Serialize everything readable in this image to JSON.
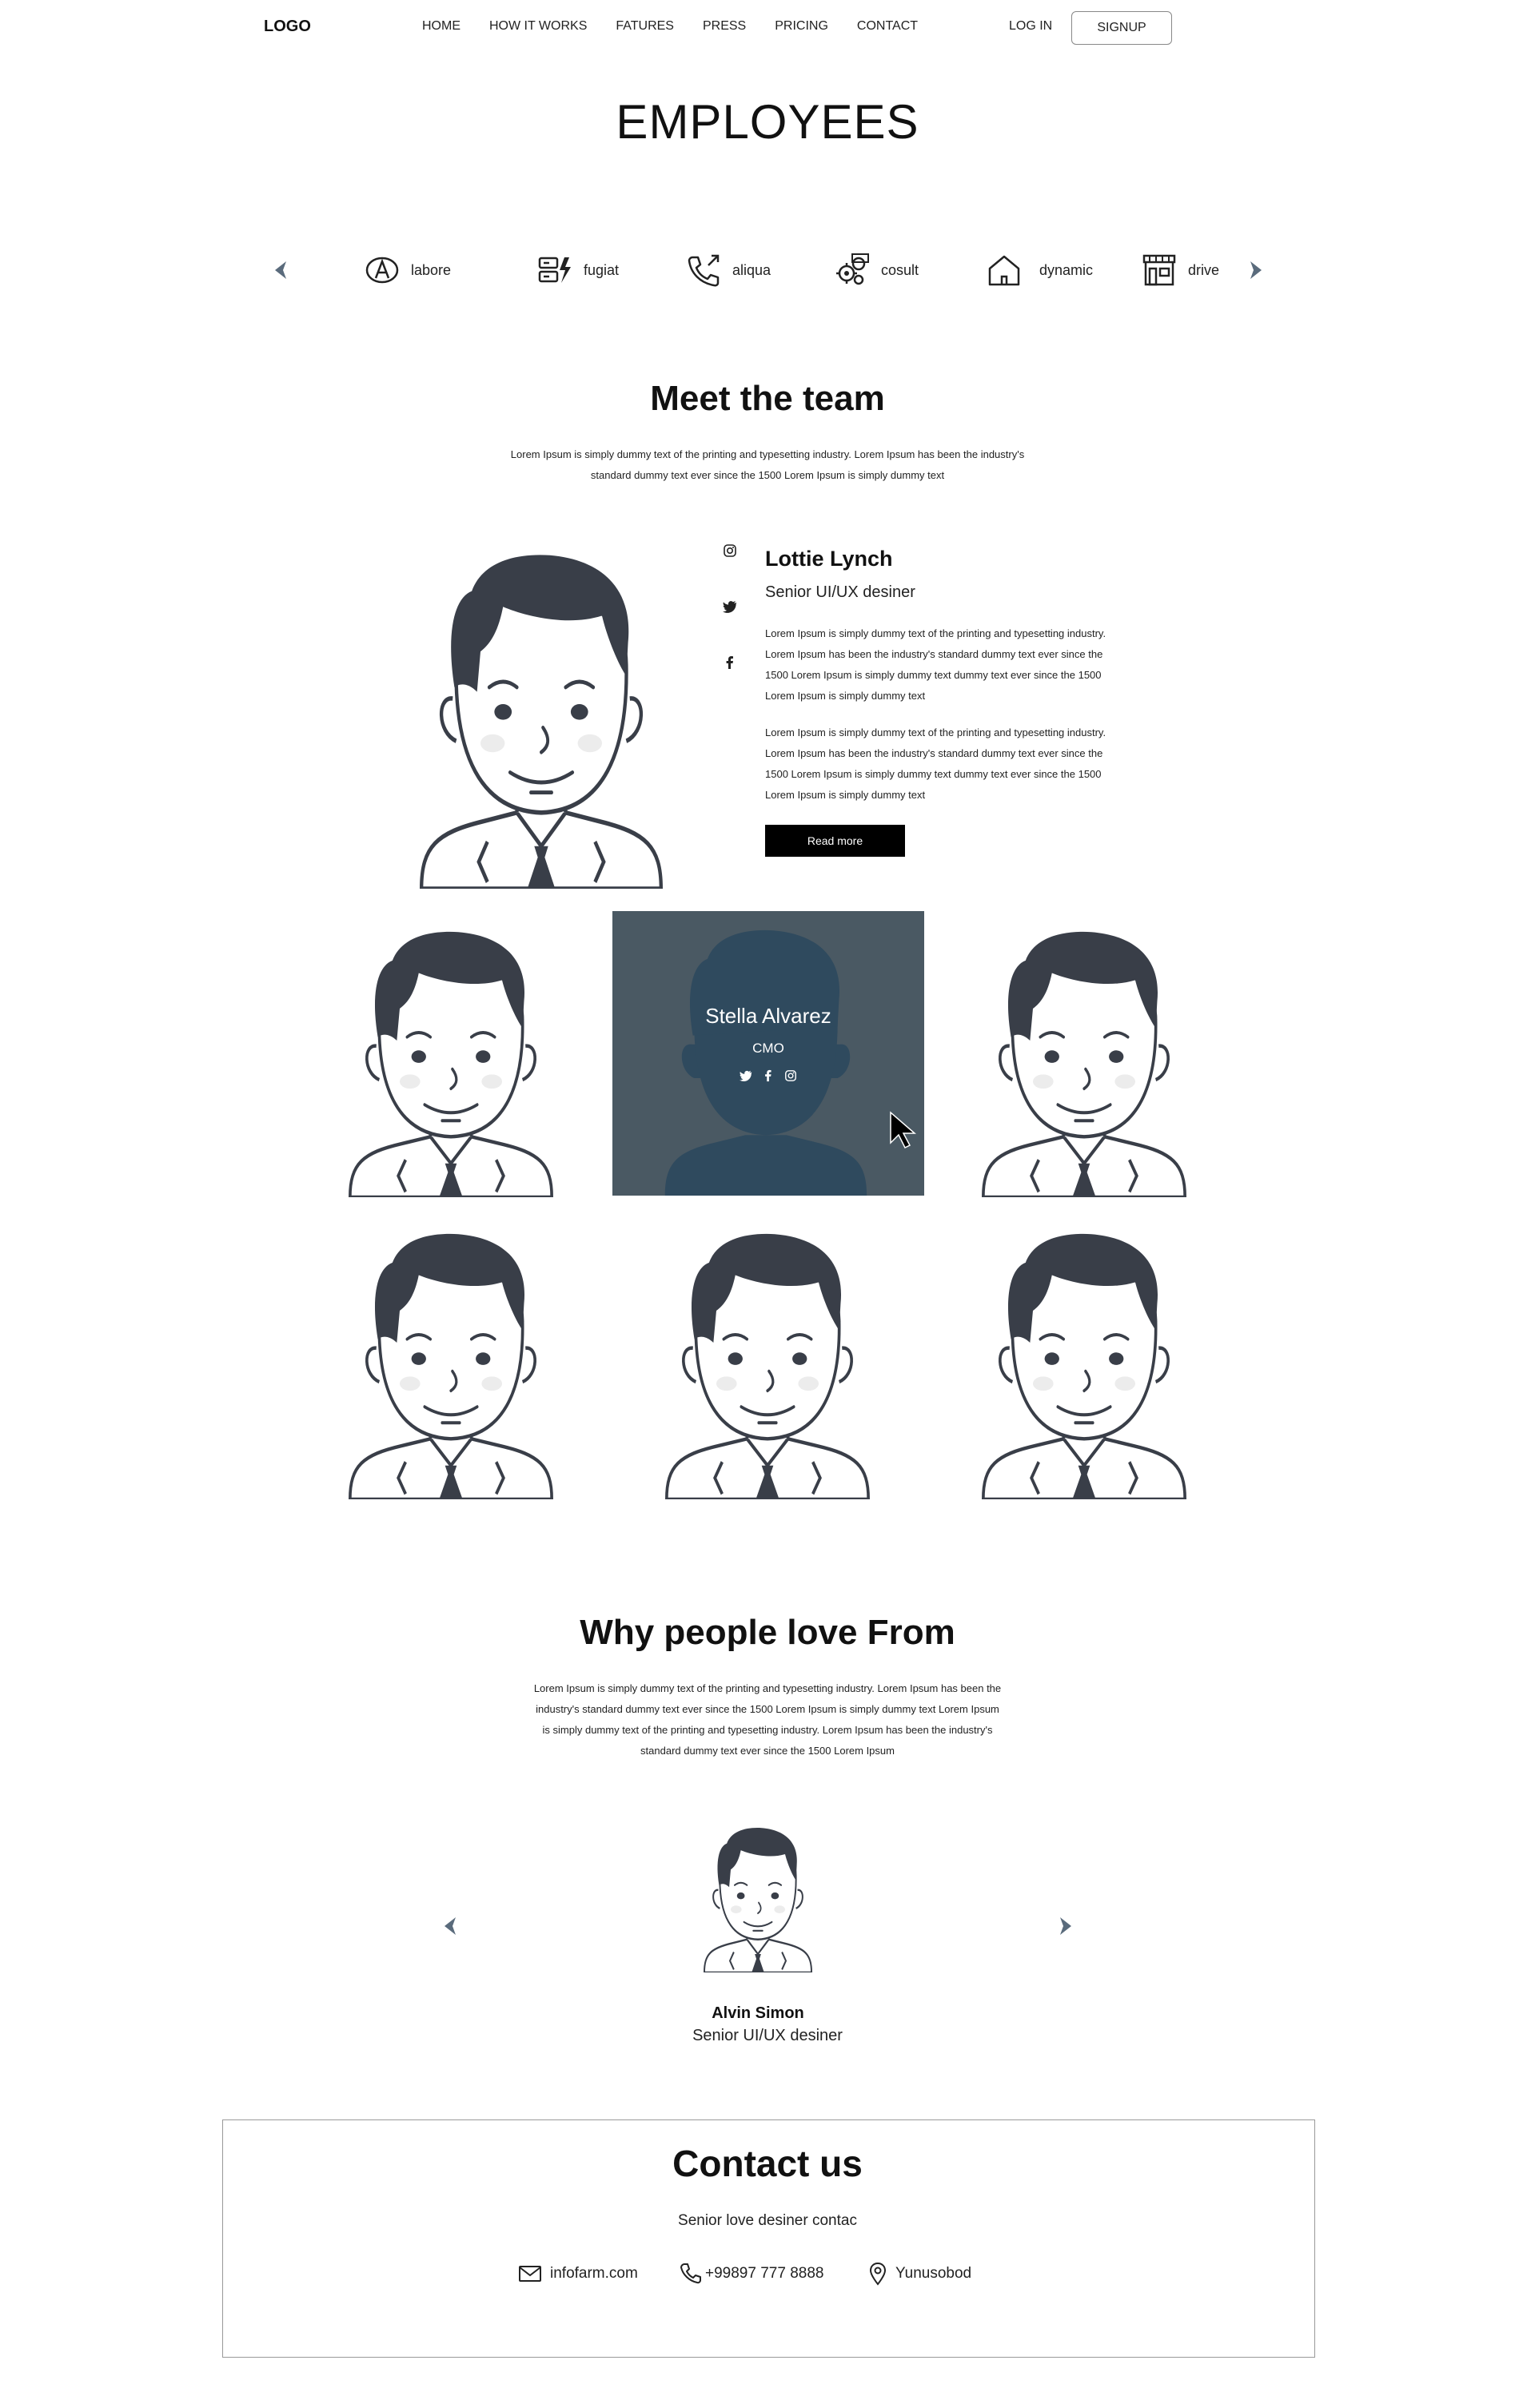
{
  "nav": {
    "logo": "LOGO",
    "links": [
      "HOME",
      "HOW IT WORKS",
      "FATURES",
      "PRESS",
      "PRICING",
      "CONTACT"
    ],
    "login": "LOG IN",
    "signup": "SIGNUP"
  },
  "page_title": "EMPLOYEES",
  "categories": [
    {
      "label": "labore",
      "icon": "badge-a-icon"
    },
    {
      "label": "fugiat",
      "icon": "server-bolt-icon"
    },
    {
      "label": "aliqua",
      "icon": "phone-outgoing-icon"
    },
    {
      "label": "cosult",
      "icon": "gears-icon"
    },
    {
      "label": "dynamic",
      "icon": "house-icon"
    },
    {
      "label": "drive",
      "icon": "storefront-icon"
    }
  ],
  "team": {
    "title": "Meet the team",
    "lead_line1": "Lorem Ipsum is simply dummy text of the printing and typesetting industry. Lorem Ipsum has been the industry's",
    "lead_line2": "standard dummy text ever since the 1500 Lorem Ipsum is simply dummy text"
  },
  "featured": {
    "name": "Lottie Lynch",
    "role": "Senior UI/UX desiner",
    "bio1": "Lorem Ipsum is simply dummy text of the printing and typesetting industry. Lorem Ipsum has been the industry's standard dummy text ever since the 1500 Lorem Ipsum is simply dummy text dummy text ever since the 1500 Lorem Ipsum is simply dummy text",
    "bio2": "Lorem Ipsum is simply dummy text of the printing and typesetting industry. Lorem Ipsum has been the industry's standard dummy text ever since the 1500 Lorem Ipsum is simply dummy text dummy text ever since the 1500 Lorem Ipsum is simply dummy text",
    "button": "Read more",
    "socials": [
      "instagram-icon",
      "twitter-icon",
      "facebook-icon"
    ]
  },
  "hover_card": {
    "name": "Stella Alvarez",
    "role": "CMO",
    "socials": [
      "twitter-icon",
      "facebook-icon",
      "instagram-icon"
    ]
  },
  "why": {
    "title": "Why people love From",
    "line1": "Lorem Ipsum is simply dummy text of the printing and typesetting industry. Lorem Ipsum has been the",
    "line2": "industry's standard dummy text ever since the 1500 Lorem Ipsum is simply dummy text Lorem Ipsum",
    "line3": "is simply dummy text of the printing and typesetting industry. Lorem Ipsum has been the industry's",
    "line4": "standard dummy text ever since the 1500 Lorem Ipsum"
  },
  "testimonial": {
    "name": "Alvin Simon",
    "role": "Senior UI/UX desiner"
  },
  "contact": {
    "title": "Contact us",
    "subtitle": "Senior love desiner contac",
    "email": "infofarm.com",
    "phone": "+99897 777 8888",
    "location": "Yunusobod"
  },
  "colors": {
    "hair": "#393e48",
    "overlay": "#4a5963",
    "silhouette": "#2f4a5e",
    "arrow": "#5a6b7c"
  }
}
